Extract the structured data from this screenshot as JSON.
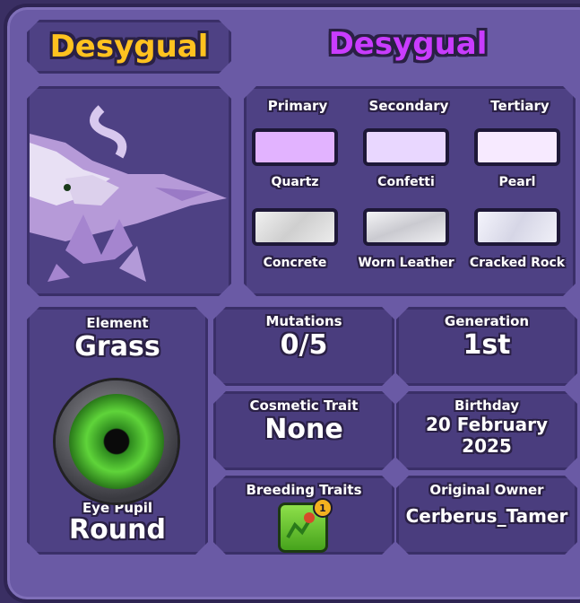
{
  "header": {
    "pet_name": "Desygual",
    "species_name": "Desygual"
  },
  "colors": {
    "column_headers": [
      "Primary",
      "Secondary",
      "Tertiary"
    ],
    "swatches": [
      {
        "name": "Quartz",
        "hex": "#e2b3ff"
      },
      {
        "name": "Confetti",
        "hex": "#e9d7ff"
      },
      {
        "name": "Pearl",
        "hex": "#f7eaff"
      }
    ],
    "textures": [
      {
        "name": "Concrete",
        "hex": "#e2e2e2"
      },
      {
        "name": "Worn Leather",
        "hex": "#e4e4e8"
      },
      {
        "name": "Cracked Rock",
        "hex": "#eaeaf4"
      }
    ]
  },
  "stats": {
    "element_label": "Element",
    "element_value": "Grass",
    "eye_label": "Eye Pupil",
    "eye_value": "Round",
    "mutations_label": "Mutations",
    "mutations_value": "0/5",
    "generation_label": "Generation",
    "generation_value": "1st",
    "cosmetic_label": "Cosmetic Trait",
    "cosmetic_value": "None",
    "birthday_label": "Birthday",
    "birthday_line1": "20 February",
    "birthday_line2": "2025",
    "breeding_label": "Breeding Traits",
    "breeding_badge_count": "1",
    "owner_label": "Original Owner",
    "owner_value": "Cerberus_Tamer"
  },
  "icons": {
    "eye": "eye-icon",
    "breeding_trait": "plant-growth-icon"
  }
}
